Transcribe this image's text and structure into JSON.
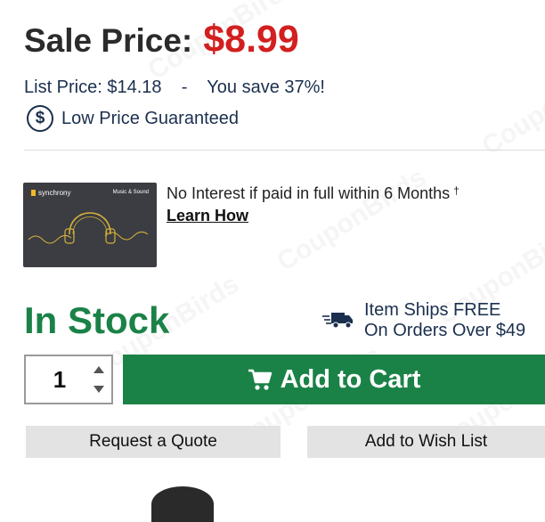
{
  "watermark": {
    "text": "CouponBirds"
  },
  "pricing": {
    "sale_label": "Sale Price:",
    "sale_price": "$8.99",
    "list_line": "List Price: $14.18    -    You save 37%!",
    "guarantee_symbol": "$",
    "guarantee_text": "Low Price Guaranteed"
  },
  "financing": {
    "card_brand": "synchrony",
    "card_type": "Music & Sound",
    "text": "No Interest if paid in full within 6 Months",
    "dagger": "†",
    "link": "Learn How"
  },
  "stock": {
    "status": "In Stock",
    "shipping_line1": "Item Ships FREE",
    "shipping_line2": "On Orders Over $49"
  },
  "purchase": {
    "quantity": "1",
    "add_to_cart": "Add to Cart",
    "request_quote": "Request a Quote",
    "add_to_wishlist": "Add to Wish List"
  },
  "colors": {
    "sale_red": "#d31f1f",
    "stock_green": "#1b8247",
    "text_navy": "#1b2f4e",
    "button_gray": "#e3e3e3"
  },
  "icons": {
    "guarantee": "dollar-circle-icon",
    "shipping": "truck-icon",
    "cart": "cart-icon",
    "quantity_up": "chevron-up-icon",
    "quantity_down": "chevron-down-icon"
  }
}
